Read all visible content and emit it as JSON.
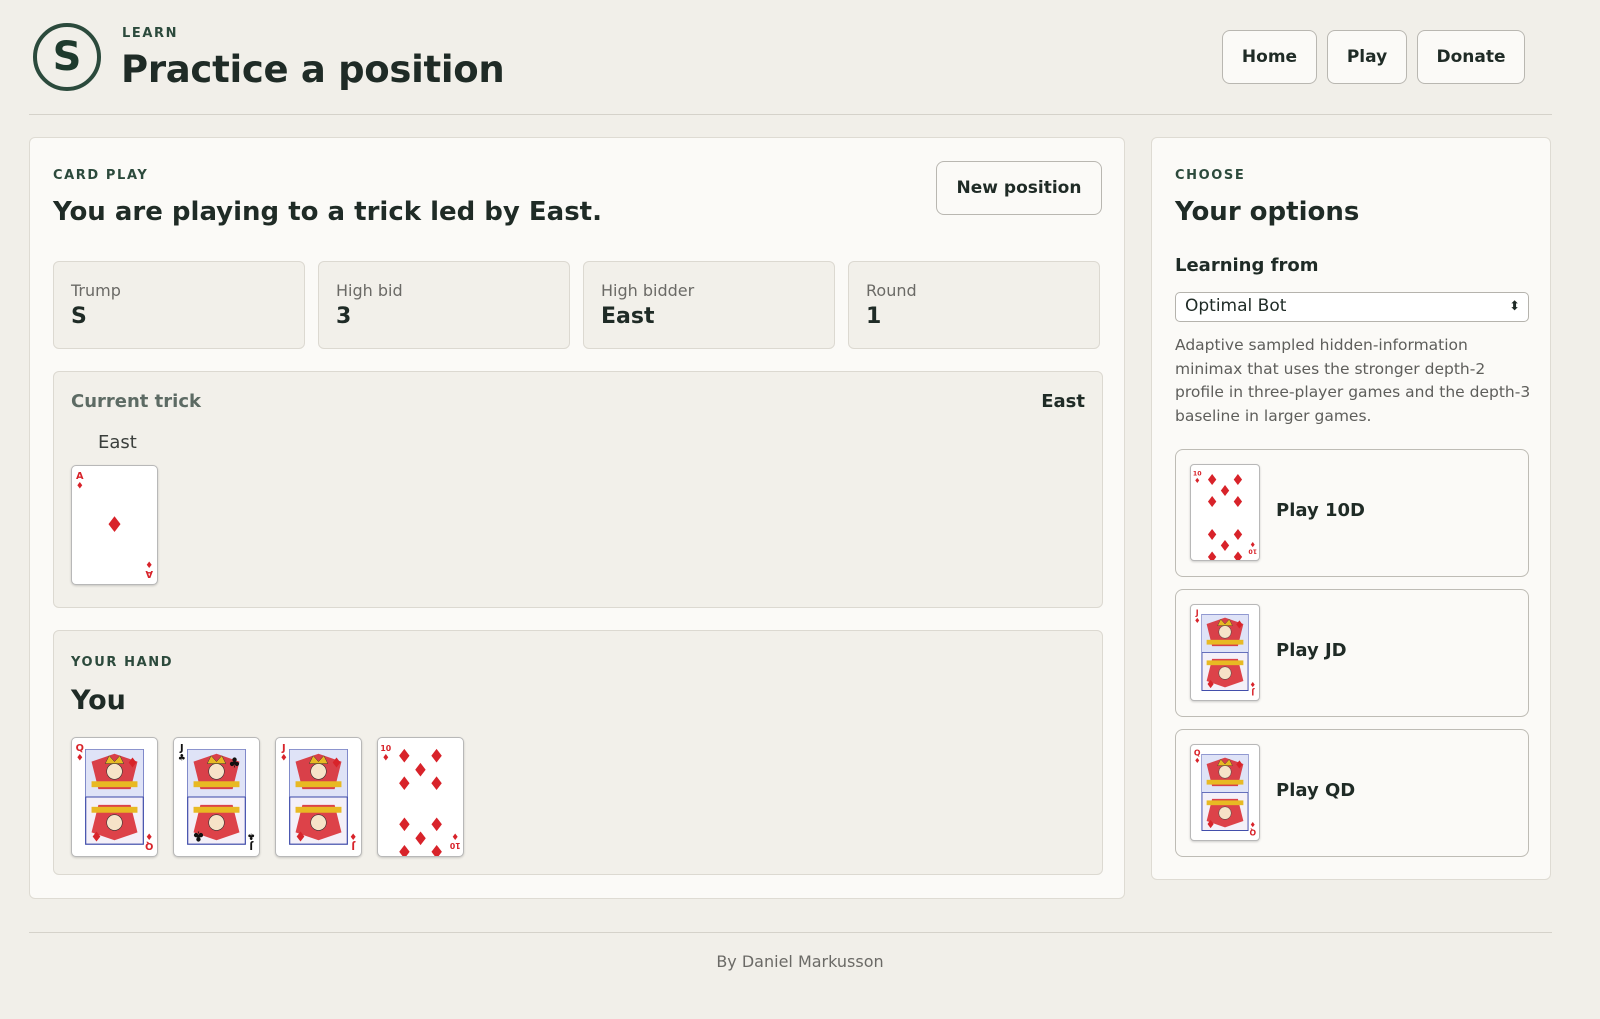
{
  "header": {
    "logo_letter": "S",
    "eyebrow": "LEARN",
    "title": "Practice a position",
    "nav": {
      "home": "Home",
      "play": "Play",
      "donate": "Donate"
    }
  },
  "main": {
    "eyebrow": "CARD PLAY",
    "heading": "You are playing to a trick led by East.",
    "new_position": "New position",
    "stats": {
      "trump": {
        "label": "Trump",
        "value": "S"
      },
      "high_bid": {
        "label": "High bid",
        "value": "3"
      },
      "high_bidder": {
        "label": "High bidder",
        "value": "East"
      },
      "round": {
        "label": "Round",
        "value": "1"
      }
    },
    "trick": {
      "title": "Current trick",
      "leader": "East",
      "seat": "East",
      "card": {
        "rank": "A",
        "suit": "diamonds"
      }
    },
    "hand": {
      "eyebrow": "YOUR HAND",
      "player": "You",
      "cards": [
        {
          "rank": "Q",
          "suit": "diamonds"
        },
        {
          "rank": "J",
          "suit": "clubs"
        },
        {
          "rank": "J",
          "suit": "diamonds"
        },
        {
          "rank": "10",
          "suit": "diamonds"
        }
      ]
    }
  },
  "sidebar": {
    "eyebrow": "CHOOSE",
    "heading": "Your options",
    "learning_label": "Learning from",
    "selected": "Optimal Bot",
    "description": "Adaptive sampled hidden-information minimax that uses the stronger depth-2 profile in three-player games and the depth-3 baseline in larger games.",
    "options": [
      {
        "label": "Play 10D",
        "card": {
          "rank": "10",
          "suit": "diamonds"
        }
      },
      {
        "label": "Play JD",
        "card": {
          "rank": "J",
          "suit": "diamonds"
        }
      },
      {
        "label": "Play QD",
        "card": {
          "rank": "Q",
          "suit": "diamonds"
        }
      }
    ]
  },
  "footer": {
    "credit": "By Daniel Markusson"
  },
  "colors": {
    "red_suit": "#d8232a",
    "black_suit": "#111111",
    "brand_green": "#2b4a3c"
  }
}
